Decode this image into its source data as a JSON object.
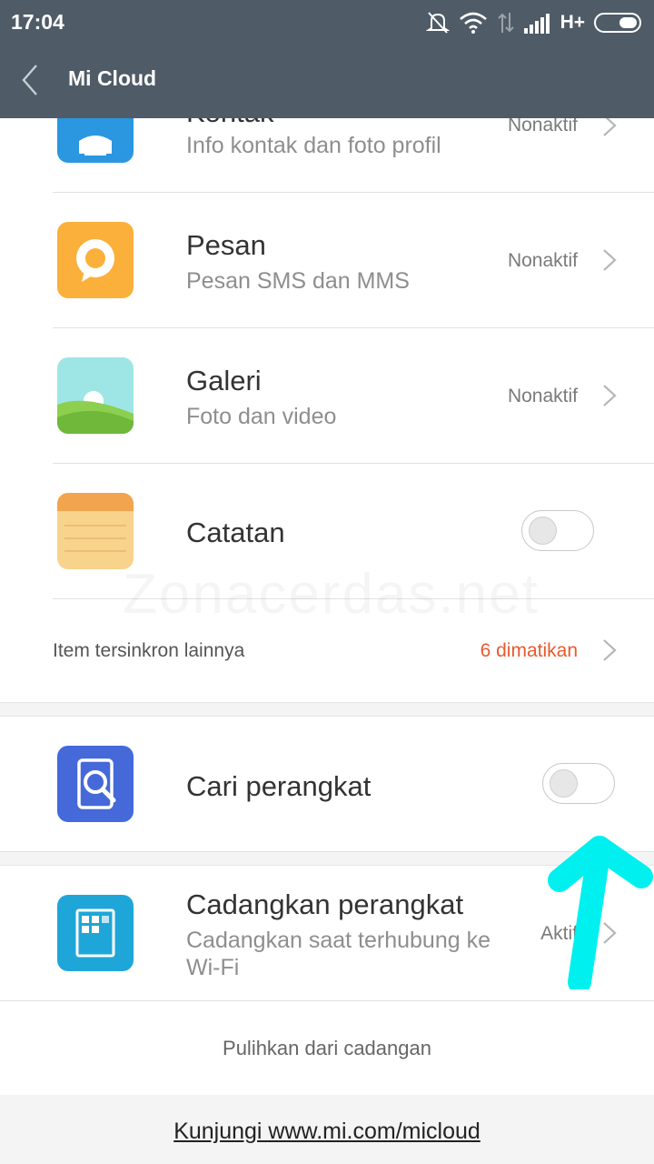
{
  "statusbar": {
    "time": "17:04",
    "network": "H+"
  },
  "appbar": {
    "title": "Mi Cloud"
  },
  "items": {
    "kontak": {
      "title": "Kontak",
      "subtitle": "Info kontak dan foto profil",
      "status": "Nonaktif"
    },
    "pesan": {
      "title": "Pesan",
      "subtitle": "Pesan SMS dan MMS",
      "status": "Nonaktif"
    },
    "galeri": {
      "title": "Galeri",
      "subtitle": "Foto dan video",
      "status": "Nonaktif"
    },
    "catatan": {
      "title": "Catatan",
      "enabled": false
    },
    "other": {
      "label": "Item tersinkron lainnya",
      "count": "6 dimatikan"
    },
    "cari": {
      "title": "Cari perangkat",
      "enabled": false
    },
    "cadangkan": {
      "title": "Cadangkan perangkat",
      "subtitle_line1": "Cadangkan saat terhubung ke",
      "subtitle_line2": "Wi-Fi",
      "status": "Aktif"
    }
  },
  "restore_label": "Pulihkan dari cadangan",
  "footer": {
    "link": "Kunjungi www.mi.com/micloud"
  },
  "watermark": "Zonacerdas.net",
  "colors": {
    "statusbar_bg": "#4f5b66",
    "accent_warning": "#e85a2e",
    "annotation": "#00f0f0"
  }
}
